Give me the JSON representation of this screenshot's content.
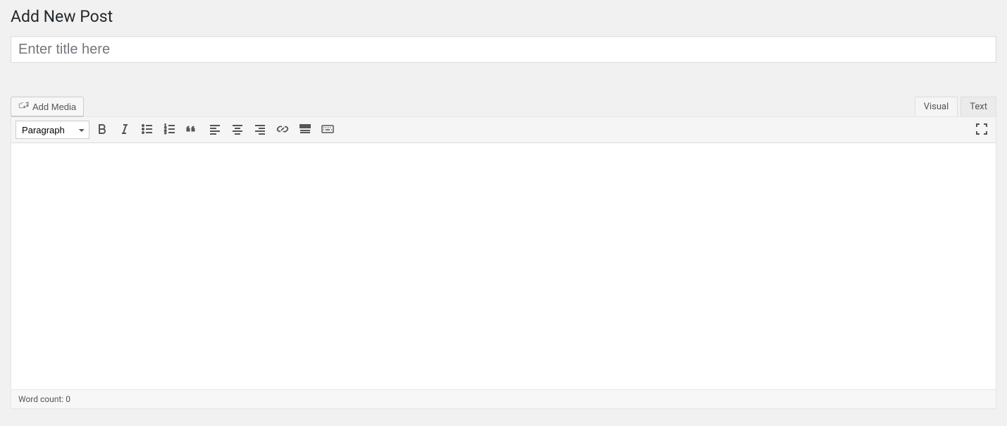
{
  "page": {
    "title": "Add New Post"
  },
  "title_field": {
    "placeholder": "Enter title here",
    "value": ""
  },
  "media_button": {
    "label": "Add Media"
  },
  "tabs": {
    "visual": "Visual",
    "text": "Text"
  },
  "toolbar": {
    "format": "Paragraph"
  },
  "editor": {
    "content": ""
  },
  "status": {
    "word_count_label": "Word count: ",
    "word_count": "0"
  }
}
